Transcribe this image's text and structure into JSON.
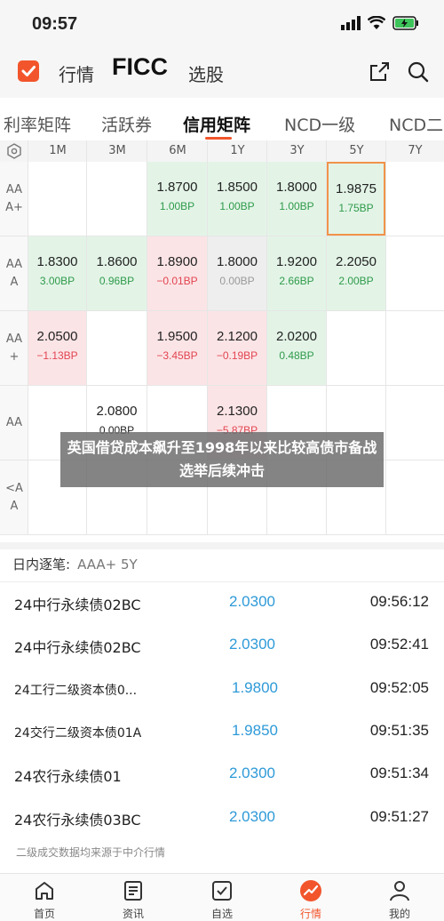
{
  "status_bar": {
    "time": "09:57"
  },
  "header": {
    "nav_hangqing": "行情",
    "nav_ficc": "FICC",
    "nav_xuangu": "选股"
  },
  "tabs": [
    "利率矩阵",
    "活跃券",
    "信用矩阵",
    "NCD一级",
    "NCD二"
  ],
  "matrix": {
    "columns": [
      "1M",
      "3M",
      "6M",
      "1Y",
      "3Y",
      "5Y",
      "7Y"
    ],
    "rows": [
      {
        "label": "AA\nA+",
        "cells": [
          null,
          null,
          {
            "rate": "1.8700",
            "bp": "1.00BP"
          },
          {
            "rate": "1.8500",
            "bp": "1.00BP"
          },
          {
            "rate": "1.8000",
            "bp": "1.00BP"
          },
          {
            "rate": "1.9875",
            "bp": "1.75BP"
          },
          null
        ]
      },
      {
        "label": "AA\nA",
        "cells": [
          {
            "rate": "1.8300",
            "bp": "3.00BP"
          },
          {
            "rate": "1.8600",
            "bp": "0.96BP"
          },
          {
            "rate": "1.8900",
            "bp": "−0.01BP"
          },
          {
            "rate": "1.8000",
            "bp": "0.00BP"
          },
          {
            "rate": "1.9200",
            "bp": "2.66BP"
          },
          {
            "rate": "2.2050",
            "bp": "2.00BP"
          },
          null
        ]
      },
      {
        "label": "AA\n+",
        "cells": [
          {
            "rate": "2.0500",
            "bp": "−1.13BP"
          },
          null,
          {
            "rate": "1.9500",
            "bp": "−3.45BP"
          },
          {
            "rate": "2.1200",
            "bp": "−0.19BP"
          },
          {
            "rate": "2.0200",
            "bp": "0.48BP"
          },
          null,
          null
        ]
      },
      {
        "label": "AA",
        "cells": [
          null,
          {
            "rate": "2.0800",
            "bp": "0.00BP"
          },
          null,
          {
            "rate": "2.1300",
            "bp": "−5.87BP"
          },
          null,
          null,
          null
        ]
      },
      {
        "label": "<A\nA",
        "cells": [
          null,
          null,
          null,
          null,
          null,
          null,
          null
        ]
      }
    ]
  },
  "overlay_banner": "英国借贷成本飙升至1998年以来比较高债市备战选举后续冲击",
  "trades": {
    "title": "日内逐笔:",
    "subtitle": "AAA+ 5Y",
    "rows": [
      {
        "name": "24中行永续债02BC",
        "price": "2.0300",
        "time": "09:56:12"
      },
      {
        "name": "24中行永续债02BC",
        "price": "2.0300",
        "time": "09:52:41"
      },
      {
        "name": "24工行二级资本债0...",
        "price": "1.9800",
        "time": "09:52:05"
      },
      {
        "name": "24交行二级资本债01A",
        "price": "1.9850",
        "time": "09:51:35"
      },
      {
        "name": "24农行永续债01",
        "price": "2.0300",
        "time": "09:51:34"
      },
      {
        "name": "24农行永续债03BC",
        "price": "2.0300",
        "time": "09:51:27"
      }
    ],
    "footnote": "二级成交数据均来源于中介行情"
  },
  "bottom_nav": [
    {
      "label": "首页",
      "icon": "home-icon"
    },
    {
      "label": "资讯",
      "icon": "news-icon"
    },
    {
      "label": "自选",
      "icon": "checkbox-icon"
    },
    {
      "label": "行情",
      "icon": "market-trend-icon"
    },
    {
      "label": "我的",
      "icon": "user-icon"
    }
  ],
  "colors": {
    "accent": "#f2552c",
    "up": "#2f9a4a",
    "down": "#e24450",
    "price": "#2e9ad8"
  }
}
